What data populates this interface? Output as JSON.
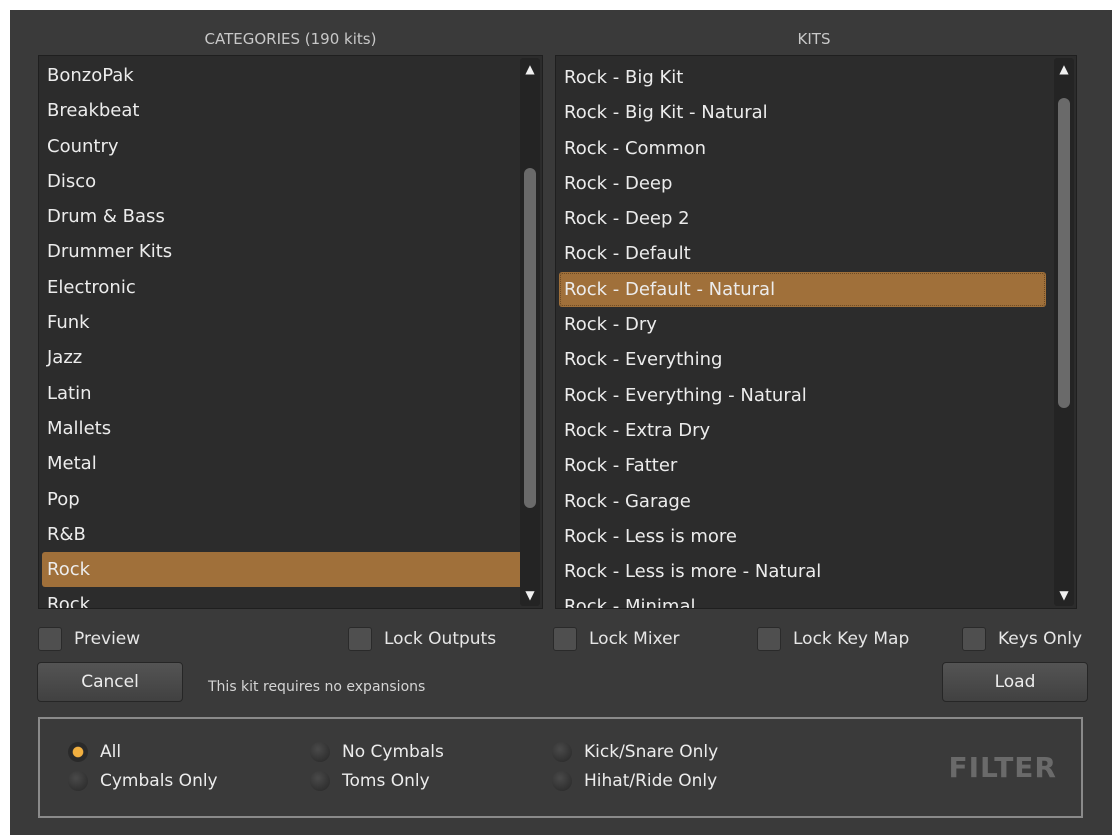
{
  "categories_panel": {
    "title": "CATEGORIES (190 kits)",
    "items": [
      "BonzoPak",
      "Breakbeat",
      "Country",
      "Disco",
      "Drum & Bass",
      "Drummer Kits",
      "Electronic",
      "Funk",
      "Jazz",
      "Latin",
      "Mallets",
      "Metal",
      "Pop",
      "R&B",
      "Rock",
      "Rock"
    ],
    "selected": "Rock"
  },
  "kits_panel": {
    "title": "KITS",
    "items": [
      "Rock - Big Kit",
      "Rock - Big Kit - Natural",
      "Rock - Common",
      "Rock - Deep",
      "Rock - Deep 2",
      "Rock - Default",
      "Rock - Default - Natural",
      "Rock - Dry",
      "Rock - Everything",
      "Rock - Everything - Natural",
      "Rock - Extra Dry",
      "Rock - Fatter",
      "Rock - Garage",
      "Rock - Less is more",
      "Rock - Less is more - Natural",
      "Rock - Minimal"
    ],
    "selected": "Rock - Default - Natural"
  },
  "options": {
    "preview": "Preview",
    "lock_outputs": "Lock Outputs",
    "lock_mixer": "Lock Mixer",
    "lock_key_map": "Lock Key Map",
    "keys_only": "Keys Only"
  },
  "actions": {
    "cancel": "Cancel",
    "load": "Load",
    "status": "This kit requires no expansions"
  },
  "filter": {
    "title": "FILTER",
    "options": [
      "All",
      "Cymbals Only",
      "No Cymbals",
      "Toms Only",
      "Kick/Snare Only",
      "Hihat/Ride Only"
    ],
    "selected": "All"
  },
  "colors": {
    "selection": "#a0703a",
    "radio_active": "#f2b040",
    "background": "#3a3a3a"
  }
}
